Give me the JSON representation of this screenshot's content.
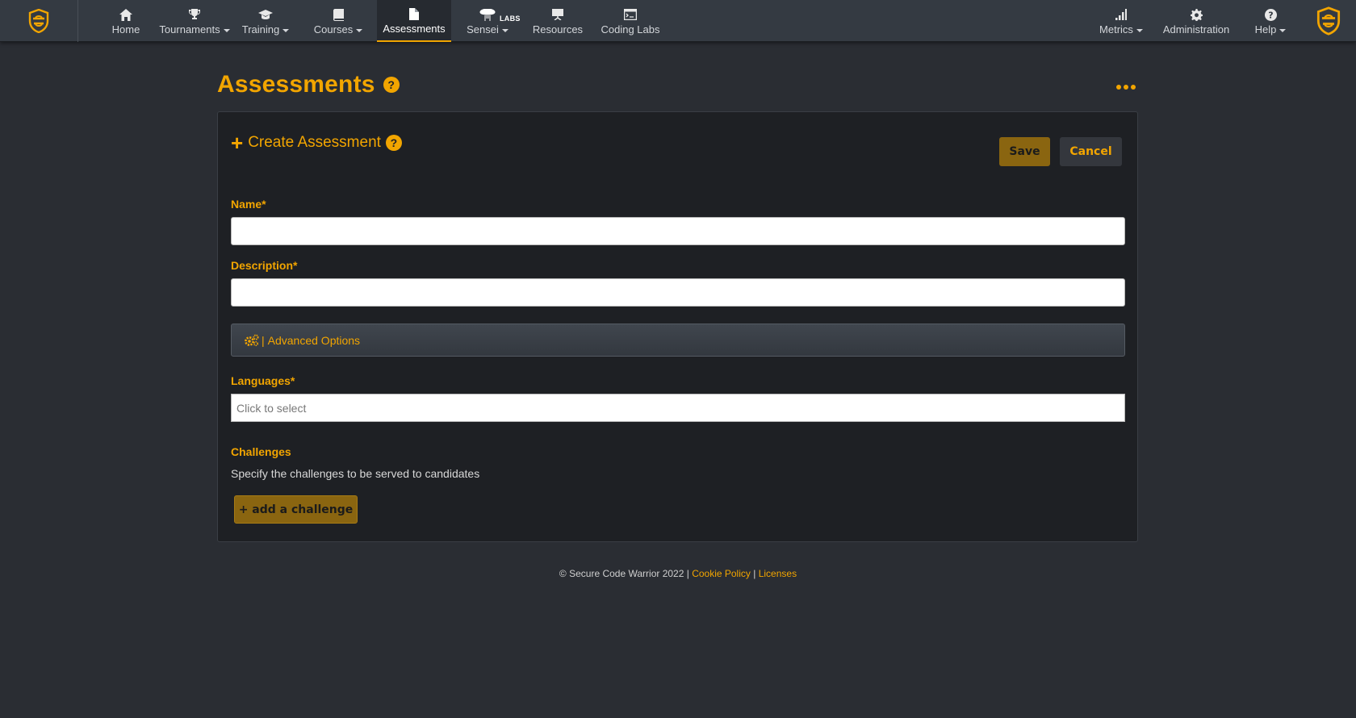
{
  "nav": {
    "left": [
      {
        "label": "Home",
        "icon": "home-icon",
        "dropdown": false
      },
      {
        "label": "Tournaments",
        "icon": "trophy-icon",
        "dropdown": true
      },
      {
        "label": "Training",
        "icon": "graduation-cap-icon",
        "dropdown": true
      },
      {
        "label": "Courses",
        "icon": "book-icon",
        "dropdown": true
      },
      {
        "label": "Assessments",
        "icon": "file-icon",
        "dropdown": false,
        "active": true
      },
      {
        "label": "Sensei",
        "icon": "sensei-icon",
        "dropdown": true,
        "badge": "LABS"
      },
      {
        "label": "Resources",
        "icon": "presentation-icon",
        "dropdown": false
      },
      {
        "label": "Coding Labs",
        "icon": "code-window-icon",
        "dropdown": false
      }
    ],
    "right": [
      {
        "label": "Metrics",
        "icon": "signal-bars-icon",
        "dropdown": true
      },
      {
        "label": "Administration",
        "icon": "gear-icon",
        "dropdown": false
      },
      {
        "label": "Help",
        "icon": "question-circle-icon",
        "dropdown": true
      }
    ]
  },
  "page": {
    "title": "Assessments",
    "help_glyph": "?"
  },
  "form": {
    "title": "Create Assessment",
    "save_label": "Save",
    "cancel_label": "Cancel",
    "name_label": "Name*",
    "name_value": "",
    "description_label": "Description*",
    "description_value": "",
    "advanced_label": "Advanced Options",
    "languages_label": "Languages*",
    "languages_placeholder": "Click to select",
    "challenges_label": "Challenges",
    "challenges_desc": "Specify the challenges to be served to candidates",
    "add_challenge_label": "+ add a challenge"
  },
  "footer": {
    "copyright": "© Secure Code Warrior 2022 |",
    "cookie": "Cookie Policy",
    "sep": "|",
    "licenses": "Licenses"
  },
  "colors": {
    "accent": "#f2a500",
    "nav_bg": "#343a42",
    "page_bg": "#2a2d33",
    "panel_bg": "#1e2024",
    "button_bg": "#8a6510"
  }
}
